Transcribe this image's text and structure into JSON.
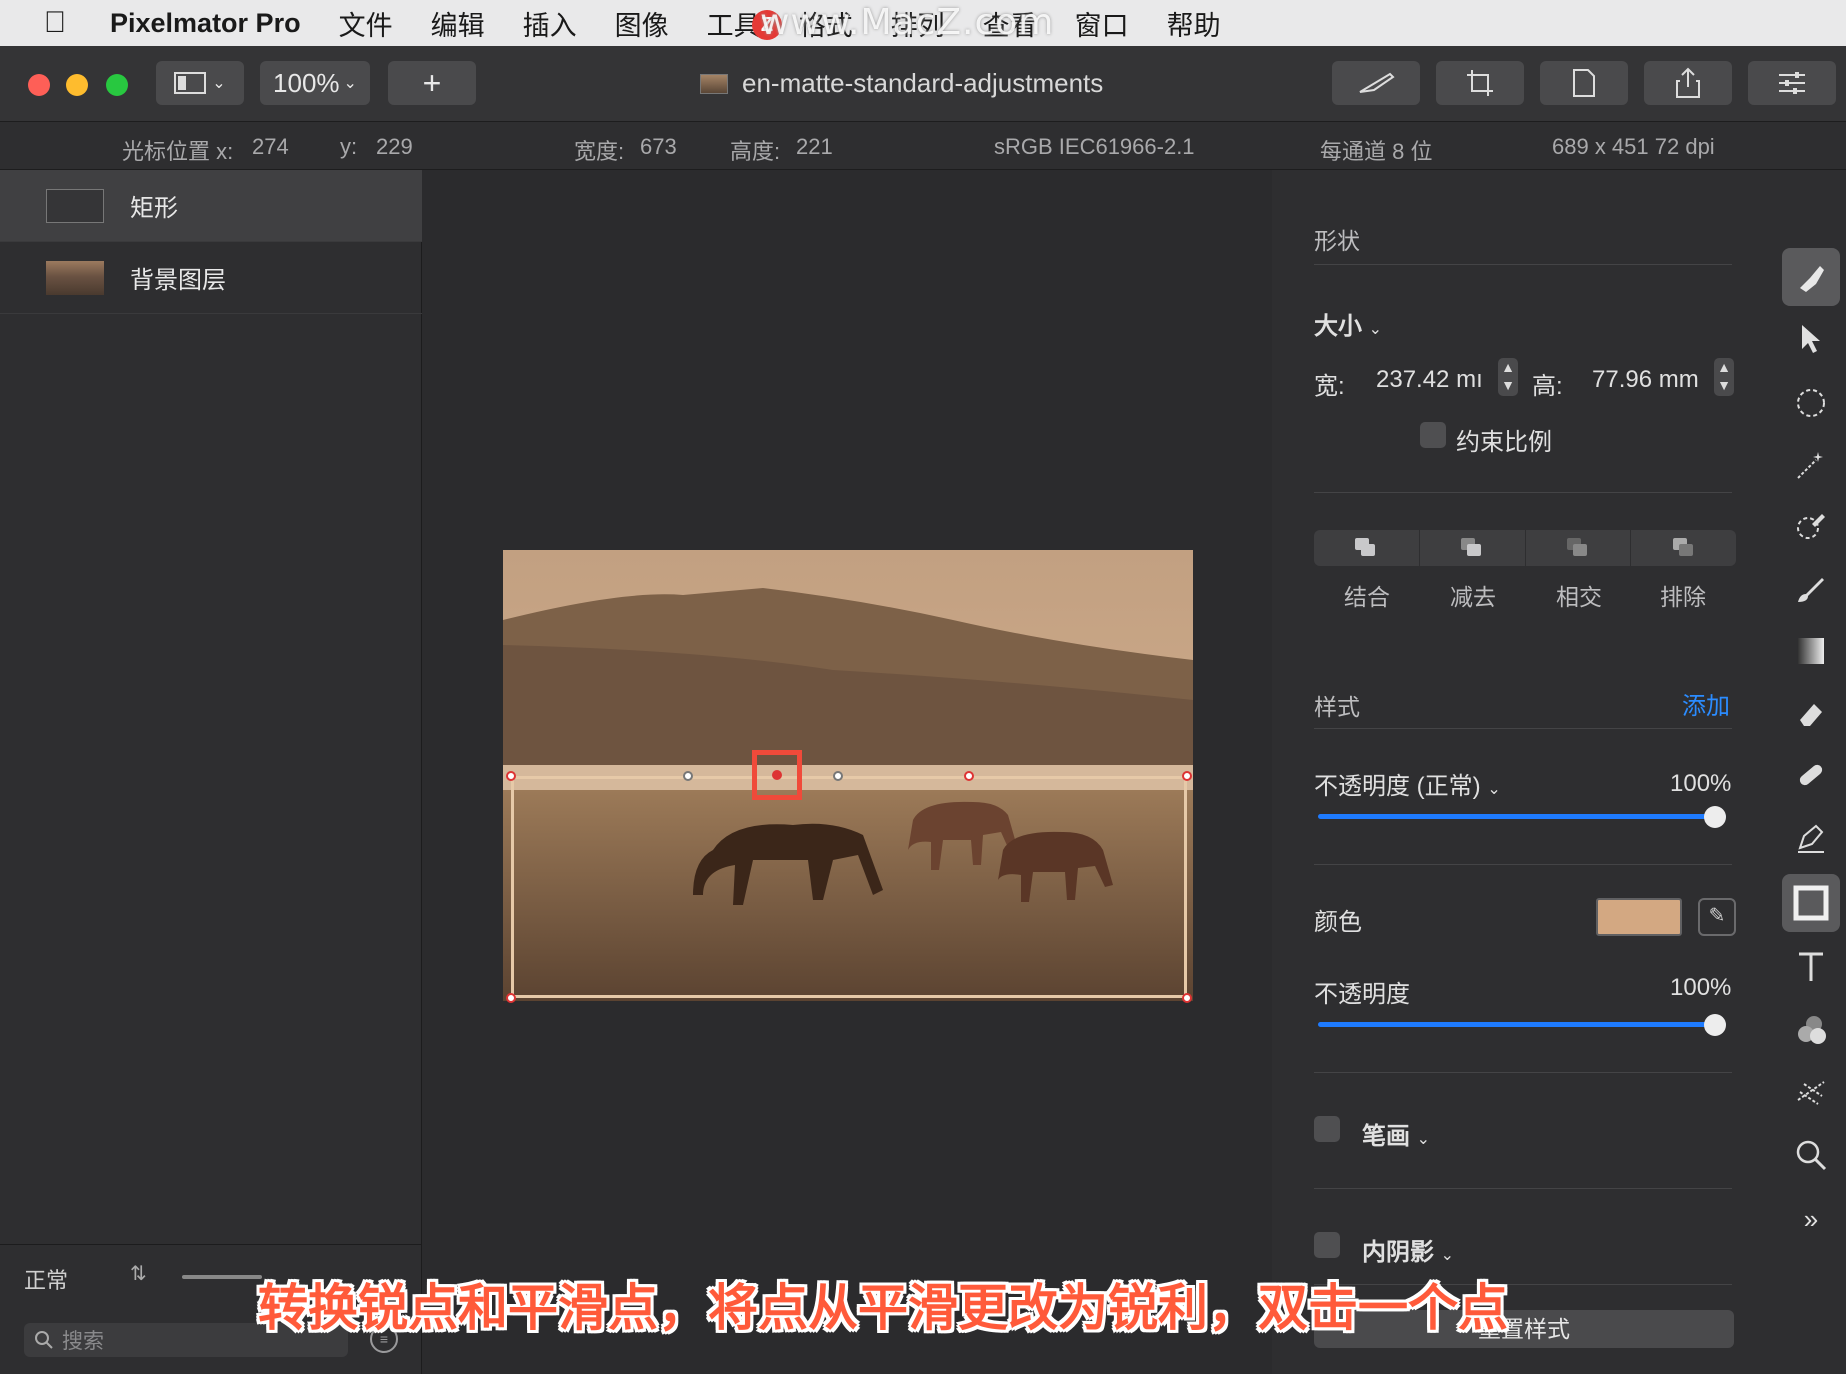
{
  "menubar": {
    "app_name": "Pixelmator Pro",
    "items": [
      "文件",
      "编辑",
      "插入",
      "图像",
      "工具",
      "格式",
      "排列",
      "查看",
      "窗口",
      "帮助"
    ]
  },
  "watermark": {
    "text": "www.MacZ.com",
    "logo": "Z"
  },
  "toolbar": {
    "zoom": "100%",
    "add_label": "+",
    "document_title": "en-matte-standard-adjustments"
  },
  "infobar": {
    "cursor_x_label": "光标位置 x:",
    "cursor_x": "274",
    "cursor_y_label": "y:",
    "cursor_y": "229",
    "width_label": "宽度:",
    "width": "673",
    "height_label": "高度:",
    "height": "221",
    "color_profile": "sRGB IEC61966-2.1",
    "bit_depth": "每通道 8 位",
    "image_size": "689 x 451 72 dpi"
  },
  "layers": {
    "items": [
      {
        "name": "矩形",
        "selected": true
      },
      {
        "name": "背景图层",
        "selected": false
      }
    ],
    "blend_mode": "正常",
    "search_placeholder": "搜索"
  },
  "inspector": {
    "section_shape": "形状",
    "size_label": "大小",
    "width_label": "宽:",
    "width_value": "237.42 mı",
    "height_label": "高:",
    "height_value": "77.96 mm",
    "constrain_label": "约束比例",
    "boolean_ops": [
      "结合",
      "减去",
      "相交",
      "排除"
    ],
    "style_label": "样式",
    "add_label": "添加",
    "opacity_normal_label": "不透明度 (正常)",
    "opacity_normal_value": "100%",
    "opacity_normal_fraction": 1.0,
    "color_label": "颜色",
    "fill_color": "#d3a882",
    "opacity_label": "不透明度",
    "opacity_value": "100%",
    "opacity_fraction": 1.0,
    "stroke_label": "笔画",
    "inner_shadow_label": "内阴影",
    "reset_label": "重置样式"
  },
  "caption": "转换锐点和平滑点，将点从平滑更改为锐利，双击一个点",
  "colors": {
    "accent": "#1e7bff",
    "add_link": "#2b8cff",
    "selection_box": "#f04a3a",
    "traffic_red": "#fe5f57",
    "traffic_yellow": "#febc2e",
    "traffic_green": "#28c840"
  }
}
